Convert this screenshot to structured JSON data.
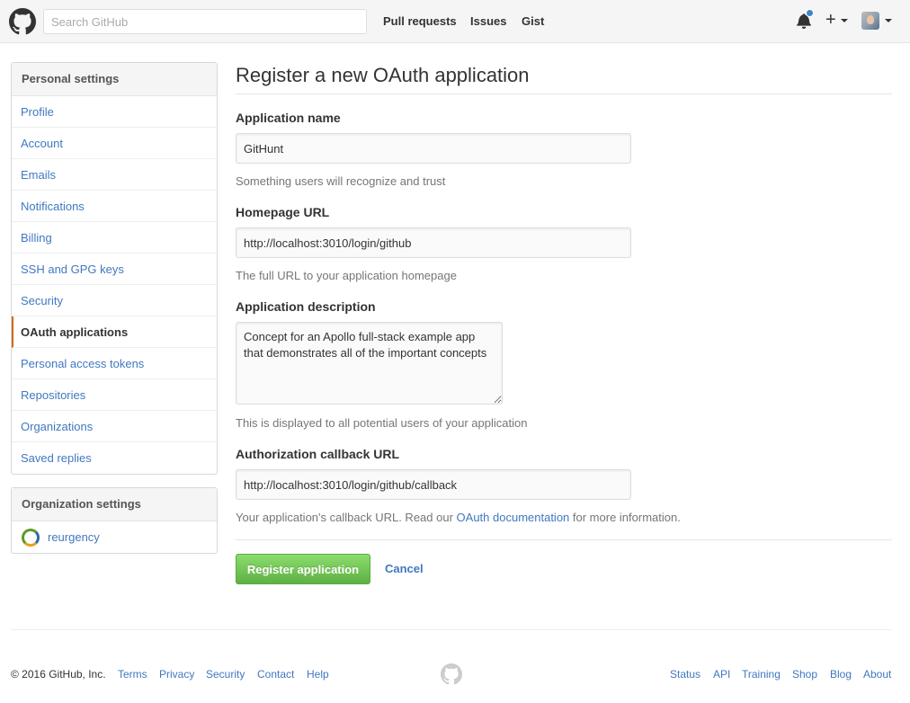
{
  "header": {
    "search_placeholder": "Search GitHub",
    "nav": [
      "Pull requests",
      "Issues",
      "Gist"
    ],
    "notification_color": "#4183c4"
  },
  "sidebar": {
    "personal_heading": "Personal settings",
    "items": [
      {
        "label": "Profile"
      },
      {
        "label": "Account"
      },
      {
        "label": "Emails"
      },
      {
        "label": "Notifications"
      },
      {
        "label": "Billing"
      },
      {
        "label": "SSH and GPG keys"
      },
      {
        "label": "Security"
      },
      {
        "label": "OAuth applications",
        "selected": true
      },
      {
        "label": "Personal access tokens"
      },
      {
        "label": "Repositories"
      },
      {
        "label": "Organizations"
      },
      {
        "label": "Saved replies"
      }
    ],
    "org_heading": "Organization settings",
    "org_items": [
      {
        "label": "reurgency"
      }
    ]
  },
  "form": {
    "title": "Register a new OAuth application",
    "app_name": {
      "label": "Application name",
      "value": "GitHunt",
      "note": "Something users will recognize and trust"
    },
    "homepage": {
      "label": "Homepage URL",
      "value": "http://localhost:3010/login/github",
      "note": "The full URL to your application homepage"
    },
    "description": {
      "label": "Application description",
      "value": "Concept for an Apollo full-stack example app that demonstrates all of the important concepts",
      "note": "This is displayed to all potential users of your application"
    },
    "callback": {
      "label": "Authorization callback URL",
      "value": "http://localhost:3010/login/github/callback",
      "note_prefix": "Your application's callback URL. Read our ",
      "note_link": "OAuth documentation",
      "note_suffix": " for more information."
    },
    "submit_label": "Register application",
    "cancel_label": "Cancel",
    "accent_color": "#60b044"
  },
  "footer": {
    "copyright": "© 2016 GitHub, Inc.",
    "left_links": [
      "Terms",
      "Privacy",
      "Security",
      "Contact",
      "Help"
    ],
    "right_links": [
      "Status",
      "API",
      "Training",
      "Shop",
      "Blog",
      "About"
    ]
  }
}
